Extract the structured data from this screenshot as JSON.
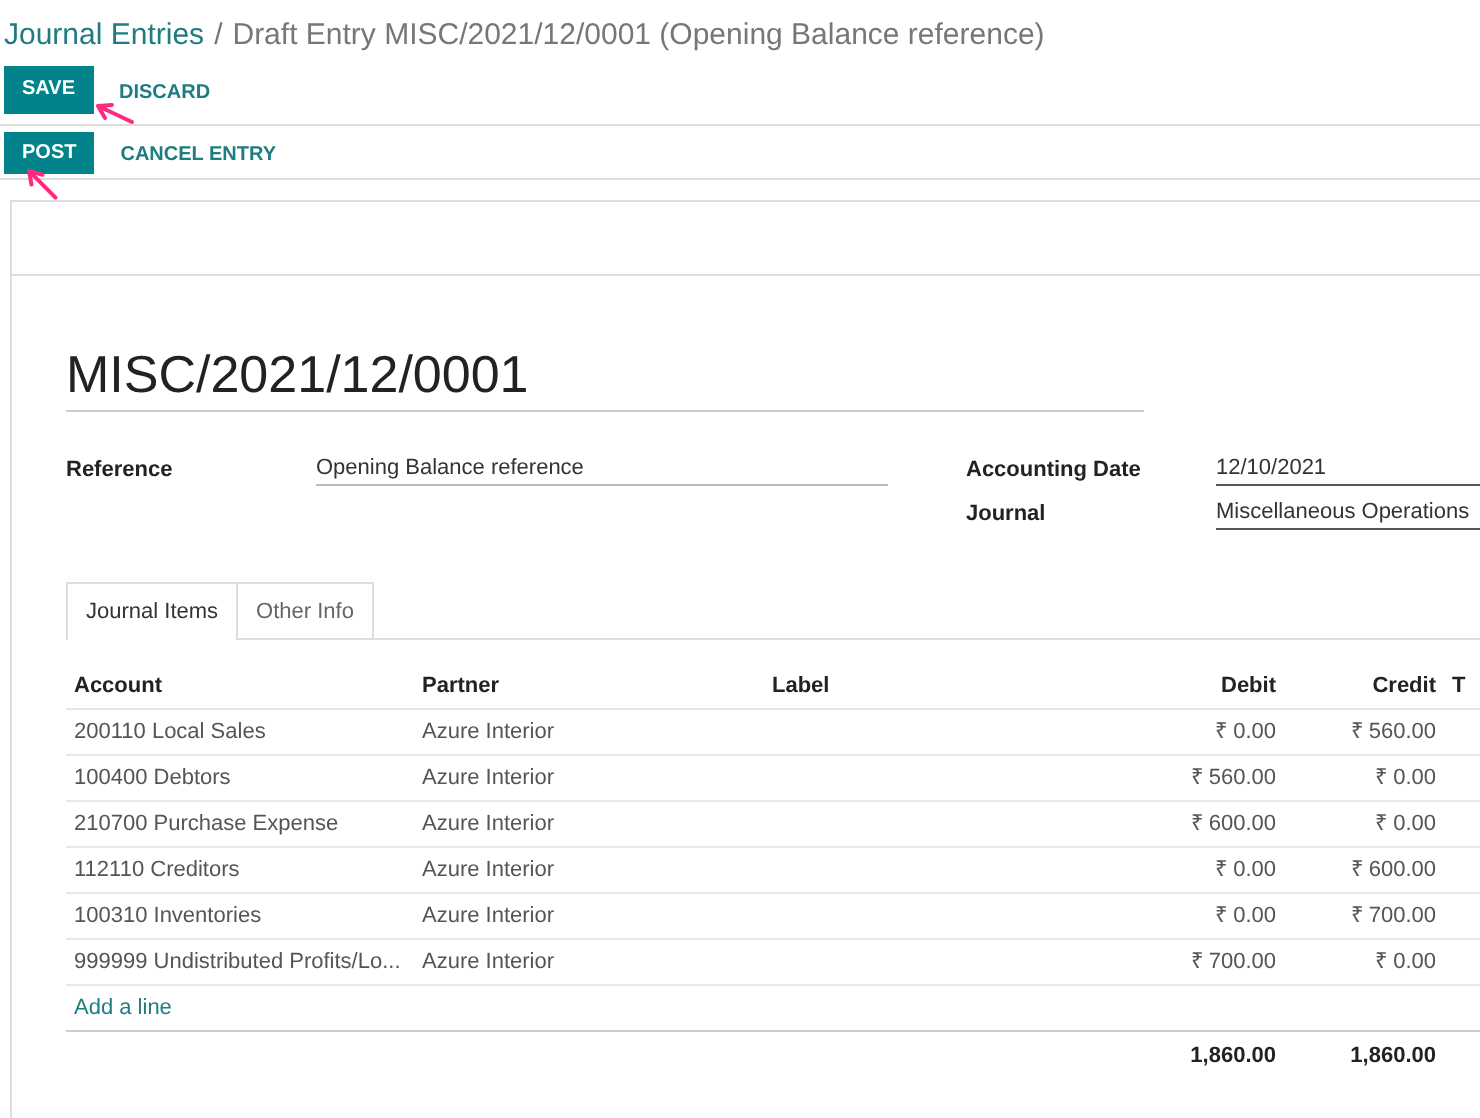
{
  "breadcrumb": {
    "parent": "Journal Entries",
    "separator": "/",
    "current": "Draft Entry MISC/2021/12/0001 (Opening Balance reference)"
  },
  "control_panel": {
    "buttons": [
      {
        "label": "SAVE",
        "kind": "primary",
        "highlighted": true
      },
      {
        "label": "DISCARD",
        "kind": "link",
        "highlighted": false
      }
    ]
  },
  "status_bar": {
    "buttons": [
      {
        "label": "POST",
        "kind": "primary",
        "highlighted": true
      },
      {
        "label": "CANCEL ENTRY",
        "kind": "link",
        "highlighted": false
      }
    ]
  },
  "form": {
    "title": "MISC/2021/12/0001",
    "left_fields": [
      {
        "label": "Reference",
        "value": "Opening Balance reference"
      }
    ],
    "right_fields": [
      {
        "label": "Accounting Date",
        "value": "12/10/2021"
      },
      {
        "label": "Journal",
        "value": "Miscellaneous Operations"
      }
    ],
    "tabs": [
      {
        "label": "Journal Items",
        "selected": true
      },
      {
        "label": "Other Info",
        "selected": false
      }
    ],
    "table": {
      "columns": [
        "Account",
        "Partner",
        "Label",
        "Debit",
        "Credit",
        "T"
      ],
      "rows": [
        {
          "account": "200110 Local Sales",
          "partner": "Azure Interior",
          "debit": "₹ 0.00",
          "credit": "₹ 560.00"
        },
        {
          "account": "100400 Debtors",
          "partner": "Azure Interior",
          "debit": "₹ 560.00",
          "credit": "₹ 0.00"
        },
        {
          "account": "210700 Purchase Expense",
          "partner": "Azure Interior",
          "debit": "₹ 600.00",
          "credit": "₹ 0.00"
        },
        {
          "account": "112110 Creditors",
          "partner": "Azure Interior",
          "debit": "₹ 0.00",
          "credit": "₹ 600.00"
        },
        {
          "account": "100310 Inventories",
          "partner": "Azure Interior",
          "debit": "₹ 0.00",
          "credit": "₹ 700.00"
        },
        {
          "account": "999999 Undistributed Profits/Lo...",
          "partner": "Azure Interior",
          "debit": "₹ 700.00",
          "credit": "₹ 0.00"
        }
      ],
      "add_line": "Add a line",
      "totals": {
        "debit": "1,860.00",
        "credit": "1,860.00"
      }
    }
  }
}
